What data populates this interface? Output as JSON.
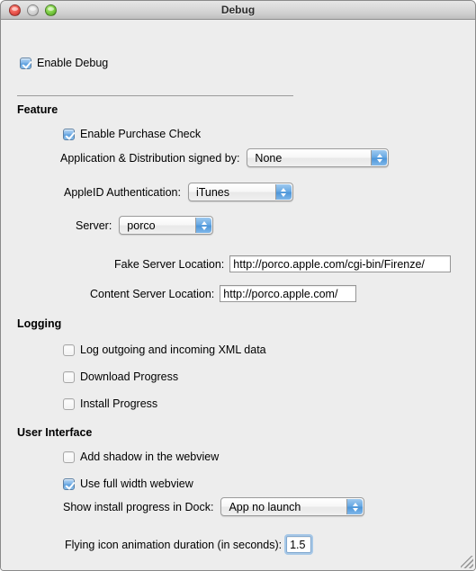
{
  "window": {
    "title": "Debug",
    "traffic_lights": [
      {
        "name": "close",
        "state": "enabled"
      },
      {
        "name": "minimize",
        "state": "disabled"
      },
      {
        "name": "zoom",
        "state": "enabled"
      }
    ]
  },
  "top": {
    "enable_debug": {
      "label": "Enable Debug",
      "checked": true
    }
  },
  "feature": {
    "section_label": "Feature",
    "enable_purchase_check": {
      "label": "Enable Purchase Check",
      "checked": true
    },
    "signed_by": {
      "label": "Application & Distribution signed by:",
      "value": "None"
    },
    "appleid_auth": {
      "label": "AppleID Authentication:",
      "value": "iTunes"
    },
    "server": {
      "label": "Server:",
      "value": "porco"
    },
    "fake_server_location": {
      "label": "Fake Server Location:",
      "value": "http://porco.apple.com/cgi-bin/Firenze/"
    },
    "content_server_location": {
      "label": "Content Server Location:",
      "value": "http://porco.apple.com/"
    }
  },
  "logging": {
    "section_label": "Logging",
    "items": [
      {
        "label": "Log outgoing and incoming XML data",
        "checked": false
      },
      {
        "label": "Download Progress",
        "checked": false
      },
      {
        "label": "Install Progress",
        "checked": false
      }
    ]
  },
  "user_interface": {
    "section_label": "User Interface",
    "add_shadow": {
      "label": "Add shadow in the webview",
      "checked": false
    },
    "full_width": {
      "label": "Use full width webview",
      "checked": true
    },
    "dock_progress": {
      "label": "Show install progress in Dock:",
      "value": "App no launch"
    },
    "flying_icon": {
      "label": "Flying icon animation duration (in seconds):",
      "value": "1.5"
    }
  },
  "colors": {
    "window_bg": "#ededed",
    "accent_blue": "#4e96d9",
    "close_red": "#e8524a",
    "zoom_green": "#76c93e"
  }
}
